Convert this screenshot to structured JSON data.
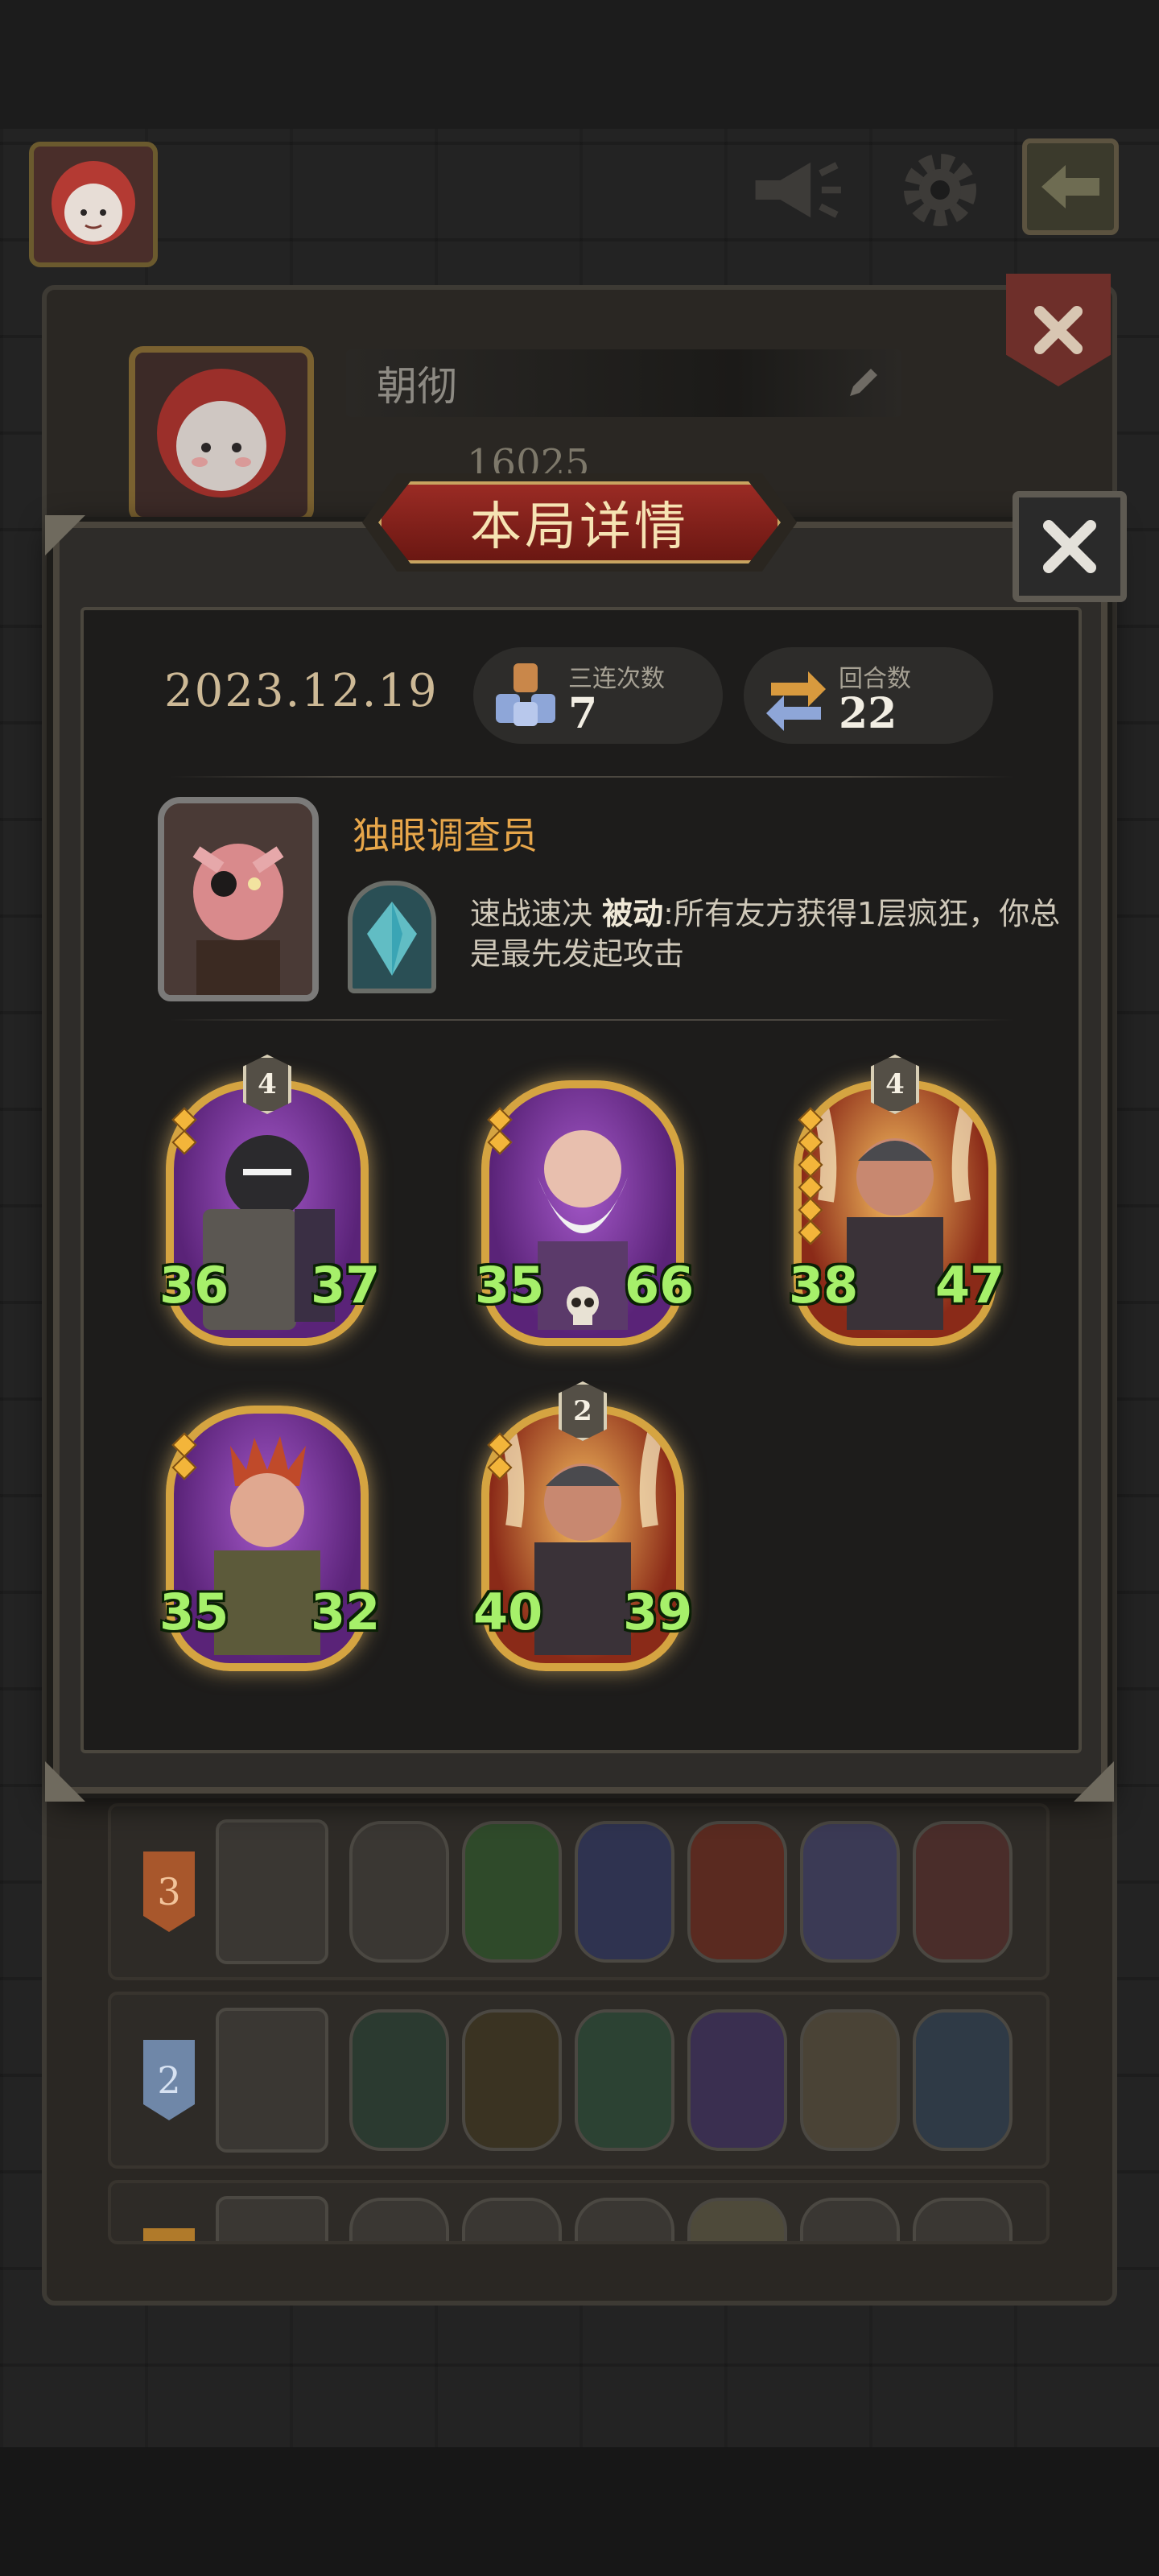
{
  "hud": {
    "speaker_icon": "megaphone-icon",
    "settings_icon": "gear-icon",
    "back_icon": "back-arrow-icon"
  },
  "profile": {
    "name": "朝彻",
    "score": "16025"
  },
  "modal": {
    "title": "本局详情",
    "date": "2023.12.19",
    "stats": [
      {
        "label": "三连次数",
        "value": "7",
        "icon": "triple-icon"
      },
      {
        "label": "回合数",
        "value": "22",
        "icon": "rounds-icon"
      }
    ],
    "hero": {
      "name": "独眼调查员",
      "skill_name": "速战速决",
      "skill_type": "被动",
      "skill_desc": ":所有友方获得1层疯狂，你总是最先发起攻击"
    },
    "units": [
      {
        "star": "4",
        "atk": "36",
        "hp": "37",
        "diamonds": 2
      },
      {
        "star": "",
        "atk": "35",
        "hp": "66",
        "diamonds": 2
      },
      {
        "star": "4",
        "atk": "38",
        "hp": "47",
        "diamonds": 6
      },
      {
        "star": "",
        "atk": "35",
        "hp": "32",
        "diamonds": 2
      },
      {
        "star": "2",
        "atk": "40",
        "hp": "39",
        "diamonds": 2
      }
    ]
  },
  "history": [
    {
      "rank": "3"
    },
    {
      "rank": "2"
    },
    {
      "rank": ""
    }
  ],
  "colors": {
    "accent_gold": "#d5a441",
    "banner_red": "#8f241d",
    "hero_name": "#e7a64a",
    "stat_green": "#a6f06a"
  }
}
